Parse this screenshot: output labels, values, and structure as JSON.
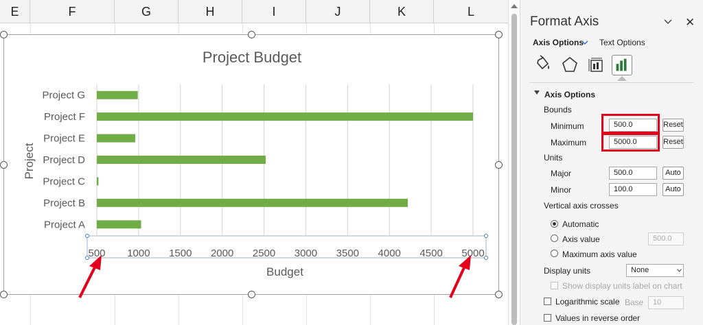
{
  "sheet": {
    "columns": [
      "E",
      "F",
      "G",
      "H",
      "I",
      "J",
      "K",
      "L"
    ]
  },
  "chart_data": {
    "type": "bar",
    "orientation": "horizontal",
    "title": "Project Budget",
    "xlabel": "Budget",
    "ylabel": "Project",
    "categories": [
      "Project A",
      "Project B",
      "Project C",
      "Project D",
      "Project E",
      "Project F",
      "Project G"
    ],
    "values": [
      1030,
      4220,
      520,
      2520,
      960,
      5000,
      990
    ],
    "xlim": [
      500,
      5000
    ],
    "xticks": [
      "500",
      "1000",
      "1500",
      "2000",
      "2500",
      "3000",
      "3500",
      "4000",
      "4500",
      "5000"
    ],
    "grid": true,
    "legend": "none",
    "bar_color": "#70ad47"
  },
  "pane": {
    "title": "Format Axis",
    "tab_axis_options": "Axis Options",
    "tab_text_options": "Text Options",
    "section_title": "Axis Options",
    "bounds_label": "Bounds",
    "minimum_label": "Minimum",
    "minimum_value": "500.0",
    "maximum_label": "Maximum",
    "maximum_value": "5000.0",
    "reset_label": "Reset",
    "units_label": "Units",
    "major_label": "Major",
    "major_value": "500.0",
    "minor_label": "Minor",
    "minor_value": "100.0",
    "auto_label": "Auto",
    "vertical_crosses_label": "Vertical axis crosses",
    "automatic_label": "Automatic",
    "axis_value_label": "Axis value",
    "axis_value_value": "500.0",
    "max_axis_value_label": "Maximum axis value",
    "display_units_label": "Display units",
    "display_units_value": "None",
    "show_units_label": "Show display units label on chart",
    "log_scale_label": "Logarithmic scale",
    "base_label": "Base",
    "base_value": "10",
    "reverse_order_label": "Values in reverse order"
  },
  "colors": {
    "bar": "#70ad47",
    "highlight": "#e2001a",
    "arrow": "#e2001a"
  }
}
